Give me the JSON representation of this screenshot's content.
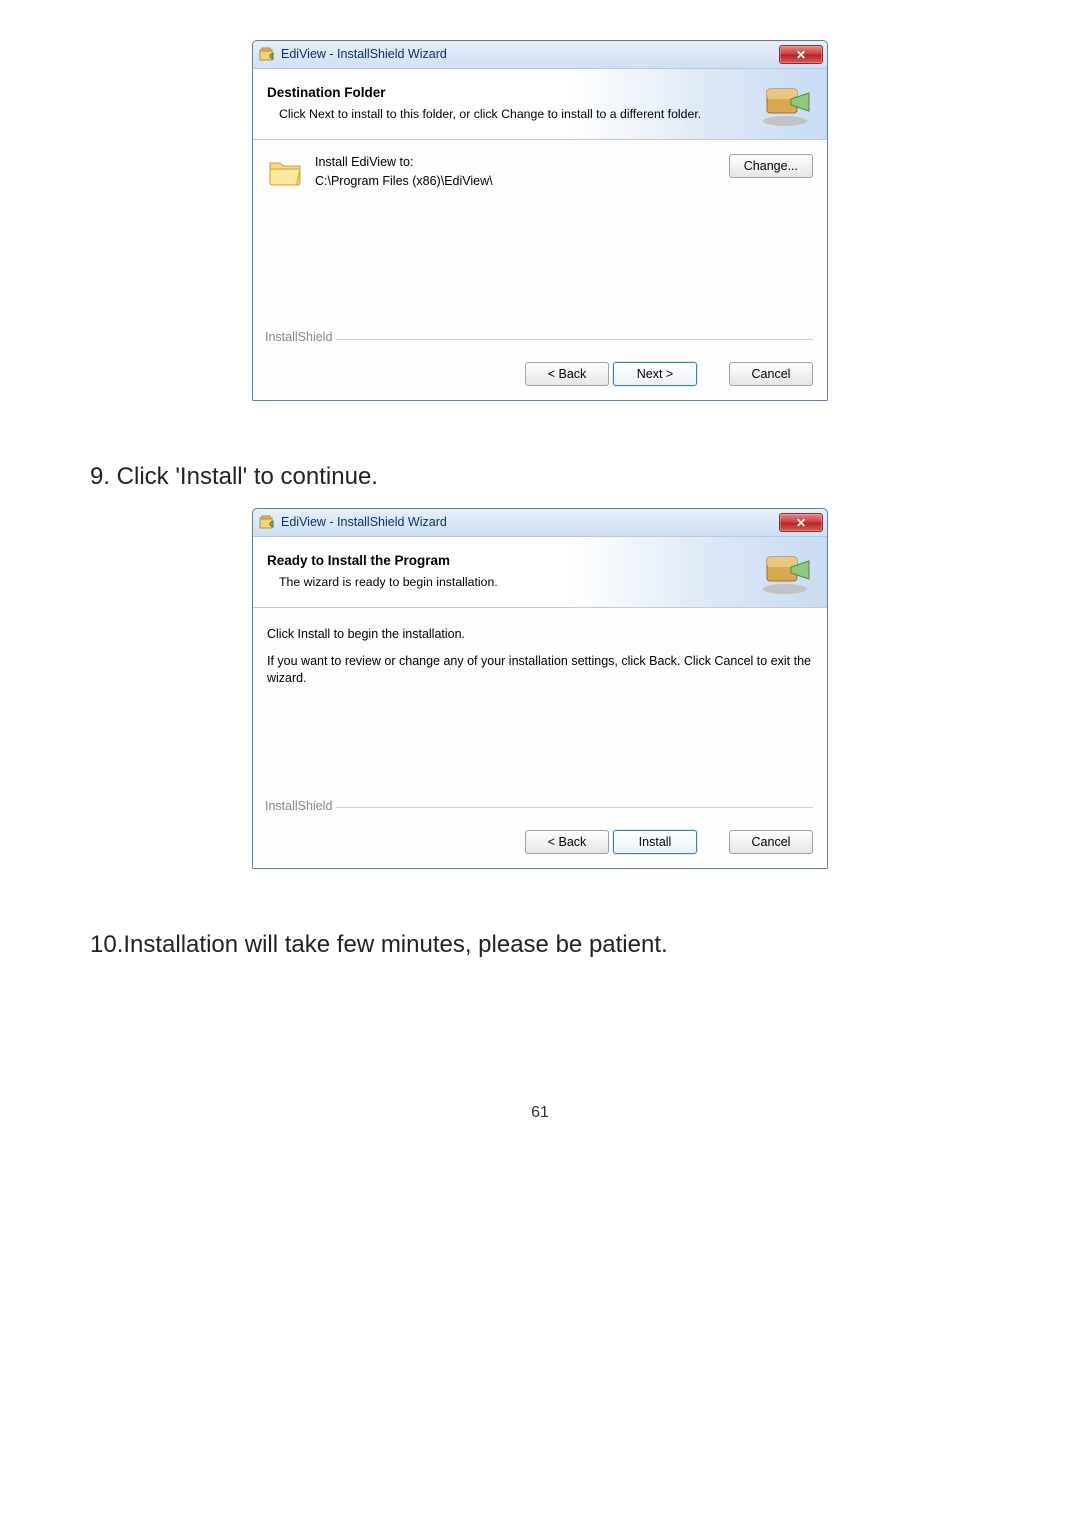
{
  "page_number": "61",
  "step9_text": "9.  Click 'Install' to continue.",
  "step10_text": "10.Installation will take few minutes, please be patient.",
  "dialog1": {
    "title": "EdiView - InstallShield Wizard",
    "header_title": "Destination Folder",
    "header_sub": "Click Next to install to this folder, or click Change to install to a different folder.",
    "install_to_label": "Install EdiView to:",
    "install_path": "C:\\Program Files (x86)\\EdiView\\",
    "change_label": "Change...",
    "fieldset_label": "InstallShield",
    "back_label": "< Back",
    "next_label": "Next >",
    "cancel_label": "Cancel"
  },
  "dialog2": {
    "title": "EdiView - InstallShield Wizard",
    "header_title": "Ready to Install the Program",
    "header_sub": "The wizard is ready to begin installation.",
    "body_line1": "Click Install to begin the installation.",
    "body_line2": "If you want to review or change any of your installation settings, click Back. Click Cancel to exit the wizard.",
    "fieldset_label": "InstallShield",
    "back_label": "< Back",
    "install_label": "Install",
    "cancel_label": "Cancel"
  }
}
